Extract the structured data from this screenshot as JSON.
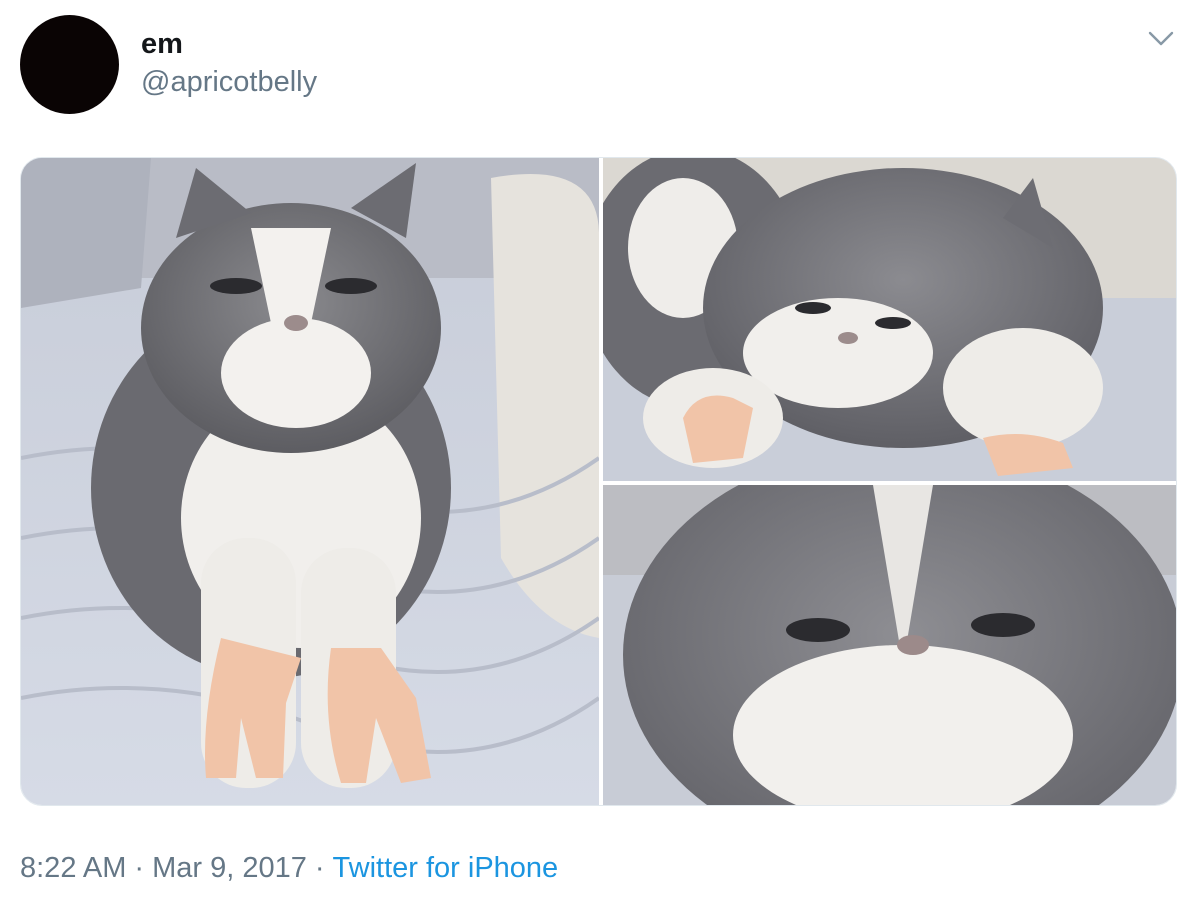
{
  "tweet": {
    "author": {
      "display_name": "em",
      "handle": "@apricotbelly",
      "avatar_icon": "avatar-circle"
    },
    "menu_icon": "chevron-down-icon",
    "media": [
      {
        "description_icon": "photo"
      },
      {
        "description_icon": "photo"
      },
      {
        "description_icon": "photo"
      }
    ],
    "time": "8:22 AM",
    "date": "Mar 9, 2017",
    "separator": "·",
    "source": "Twitter for iPhone",
    "colors": {
      "text_primary": "#14171a",
      "text_secondary": "#657786",
      "link": "#1b95e0",
      "avatar": "#0a0404"
    }
  }
}
